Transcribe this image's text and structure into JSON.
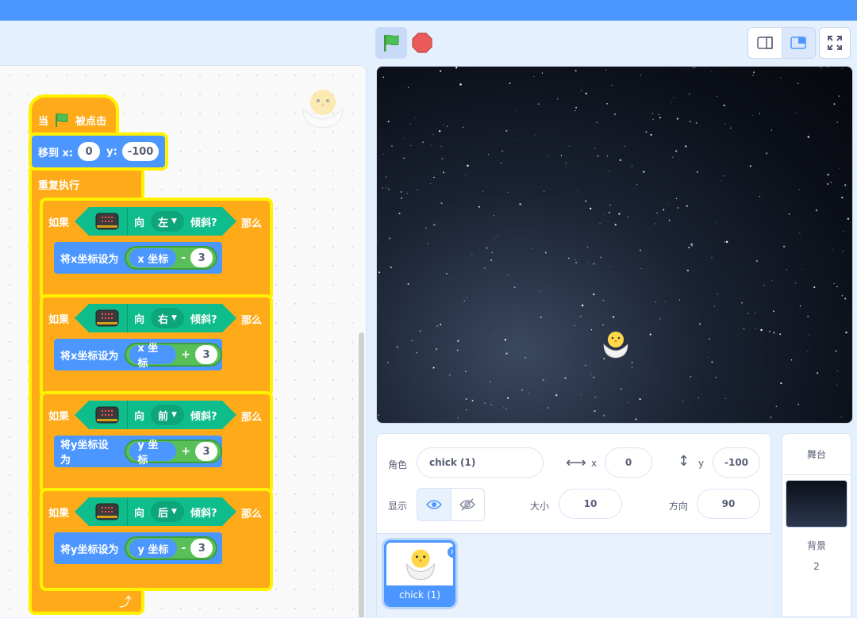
{
  "code": {
    "hat": {
      "when": "当",
      "clicked": "被点击"
    },
    "goto": {
      "label": "移到 x:",
      "x": "0",
      "y_label": "y:",
      "y": "-100"
    },
    "forever": "重复执行",
    "if_blocks": [
      {
        "if": "如果",
        "toward": "向",
        "dir": "左",
        "tilted": "倾斜?",
        "then": "那么",
        "set_label": "将x坐标设为",
        "reporter": "x 坐标",
        "op": "-",
        "value": "3"
      },
      {
        "if": "如果",
        "toward": "向",
        "dir": "右",
        "tilted": "倾斜?",
        "then": "那么",
        "set_label": "将x坐标设为",
        "reporter": "x 坐标",
        "op": "+",
        "value": "3"
      },
      {
        "if": "如果",
        "toward": "向",
        "dir": "前",
        "tilted": "倾斜?",
        "then": "那么",
        "set_label": "将y坐标设为",
        "reporter": "y 坐标",
        "op": "+",
        "value": "3"
      },
      {
        "if": "如果",
        "toward": "向",
        "dir": "后",
        "tilted": "倾斜?",
        "then": "那么",
        "set_label": "将y坐标设为",
        "reporter": "y 坐标",
        "op": "-",
        "value": "3"
      }
    ]
  },
  "sprite_info": {
    "sprite_label": "角色",
    "sprite_name": "chick (1)",
    "x_label": "x",
    "x": "0",
    "y_label": "y",
    "y": "-100",
    "show_label": "显示",
    "size_label": "大小",
    "size": "10",
    "direction_label": "方向",
    "direction": "90"
  },
  "sprites": [
    {
      "name": "chick (1)"
    }
  ],
  "stage_panel": {
    "title": "舞台",
    "backdrops_label": "背景",
    "backdrops_count": "2"
  },
  "colors": {
    "events": "#ffab19",
    "motion": "#4c97ff",
    "extension": "#0fbd8c",
    "operators": "#59c059",
    "highlight": "#fff200",
    "menu": "#4c97ff"
  }
}
